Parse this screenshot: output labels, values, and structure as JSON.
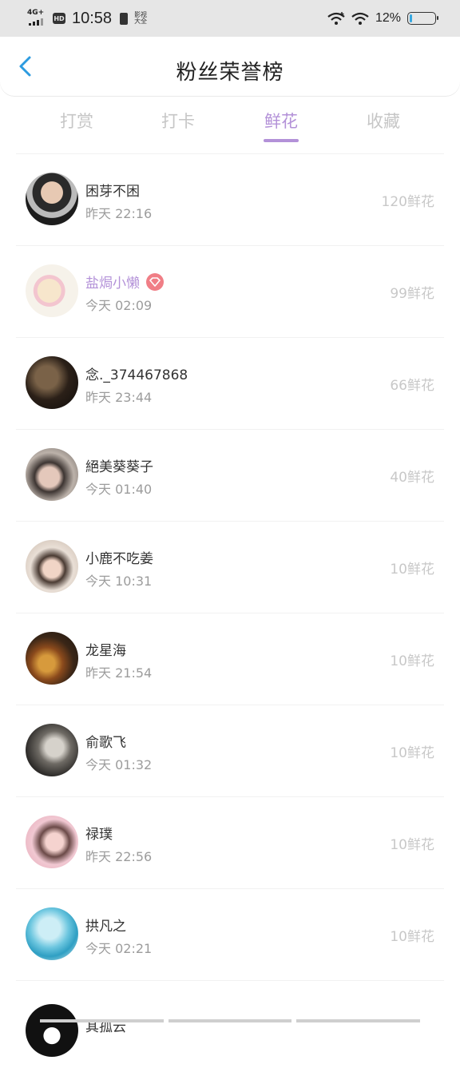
{
  "status_bar": {
    "network": "4G+",
    "hd": "HD",
    "time": "10:58",
    "app_label": "影视大全",
    "battery_pct": "12%",
    "battery_level": 0.12
  },
  "header": {
    "title": "粉丝荣誉榜",
    "back_icon": "chevron-left-icon"
  },
  "tabs": [
    {
      "label": "打赏",
      "active": false
    },
    {
      "label": "打卡",
      "active": false
    },
    {
      "label": "鲜花",
      "active": true
    },
    {
      "label": "收藏",
      "active": false
    }
  ],
  "fans": [
    {
      "name": "困芽不困",
      "time": "昨天 22:16",
      "amount": "120鲜花",
      "vip": false
    },
    {
      "name": "盐焗小懒",
      "time": "今天 02:09",
      "amount": "99鲜花",
      "vip": true
    },
    {
      "name": "念._374467868",
      "time": "昨天 23:44",
      "amount": "66鲜花",
      "vip": false
    },
    {
      "name": "絕美葵葵子",
      "time": "今天 01:40",
      "amount": "40鲜花",
      "vip": false
    },
    {
      "name": "小鹿不吃姜",
      "time": "今天 10:31",
      "amount": "10鲜花",
      "vip": false
    },
    {
      "name": "龙星海",
      "time": "昨天 21:54",
      "amount": "10鲜花",
      "vip": false
    },
    {
      "name": "俞歌飞",
      "time": "今天 01:32",
      "amount": "10鲜花",
      "vip": false
    },
    {
      "name": "禄璞",
      "time": "昨天 22:56",
      "amount": "10鲜花",
      "vip": false
    },
    {
      "name": "拱凡之",
      "time": "今天 02:21",
      "amount": "10鲜花",
      "vip": false
    },
    {
      "name": "其孤云",
      "time": "",
      "amount": "",
      "vip": false
    }
  ],
  "colors": {
    "accent": "#b391d8",
    "back_arrow": "#2d9be0",
    "badge": "#f07e86"
  }
}
